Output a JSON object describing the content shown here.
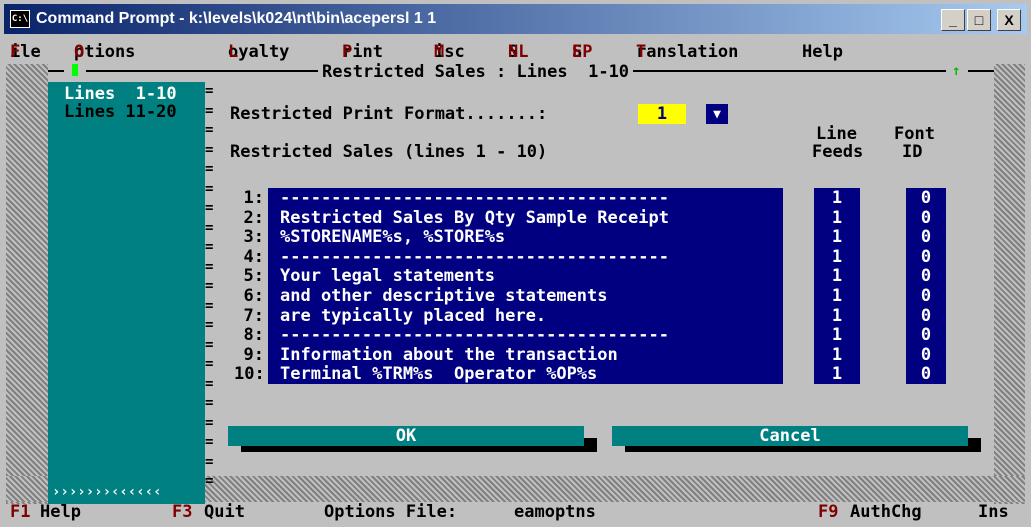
{
  "window": {
    "title": "Command Prompt - k:\\levels\\k024\\nt\\bin\\acepersl 1 1",
    "icon_label": "C:\\",
    "minimize": "_",
    "maximize": "□",
    "close": "X"
  },
  "menu": {
    "file": {
      "hot": "F",
      "rest": "ile"
    },
    "options": {
      "hot": "O",
      "rest": "ptions"
    },
    "loyalty": {
      "hot": "L",
      "rest": "oyalty"
    },
    "print": {
      "hot": "P",
      "rest": "rint"
    },
    "misc": {
      "hot": "M",
      "rest": "isc"
    },
    "nls": {
      "hot": "NL",
      "rest": "S"
    },
    "eps": {
      "hot": "EP",
      "rest": "S"
    },
    "translation": {
      "hot": "T",
      "rest": "ranslation"
    },
    "help": {
      "hot": "",
      "rest": "Help"
    }
  },
  "dialog": {
    "title": "Restricted Sales : Lines  1-10",
    "format_label": "Restricted Print Format.......:",
    "format_value": "1",
    "dropdown_glyph": "▼",
    "section_label": "Restricted Sales (lines 1 - 10)",
    "col_line_feeds_1": "Line",
    "col_line_feeds_2": "Feeds",
    "col_font_id_1": "Font",
    "col_font_id_2": "ID",
    "ok_label": "OK",
    "cancel_label": "Cancel"
  },
  "sidebar": {
    "items": [
      "Lines  1-10",
      "Lines 11-20"
    ],
    "scroll_marker": "›››››››‹‹‹‹‹‹"
  },
  "lines": [
    {
      "num": "1:",
      "text": "--------------------------------------",
      "feeds": "1",
      "font": "0"
    },
    {
      "num": "2:",
      "text": "Restricted Sales By Qty Sample Receipt",
      "feeds": "1",
      "font": "0"
    },
    {
      "num": "3:",
      "text": "%STORENAME%s, %STORE%s",
      "feeds": "1",
      "font": "0"
    },
    {
      "num": "4:",
      "text": "--------------------------------------",
      "feeds": "1",
      "font": "0"
    },
    {
      "num": "5:",
      "text": "Your legal statements",
      "feeds": "1",
      "font": "0"
    },
    {
      "num": "6:",
      "text": "and other descriptive statements",
      "feeds": "1",
      "font": "0"
    },
    {
      "num": "7:",
      "text": "are typically placed here.",
      "feeds": "1",
      "font": "0"
    },
    {
      "num": "8:",
      "text": "--------------------------------------",
      "feeds": "1",
      "font": "0"
    },
    {
      "num": "9:",
      "text": "Information about the transaction",
      "feeds": "1",
      "font": "0"
    },
    {
      "num": "10:",
      "text": "Terminal %TRM%s  Operator %OP%s",
      "feeds": "1",
      "font": "0"
    }
  ],
  "status": {
    "f1_key": "F1",
    "f1_label": "Help",
    "f3_key": "F3",
    "f3_label": "Quit",
    "options_file_label": "Options File:",
    "options_file_value": "eamoptns",
    "f9_key": "F9",
    "f9_label": "AuthChg",
    "ins": "Ins"
  }
}
